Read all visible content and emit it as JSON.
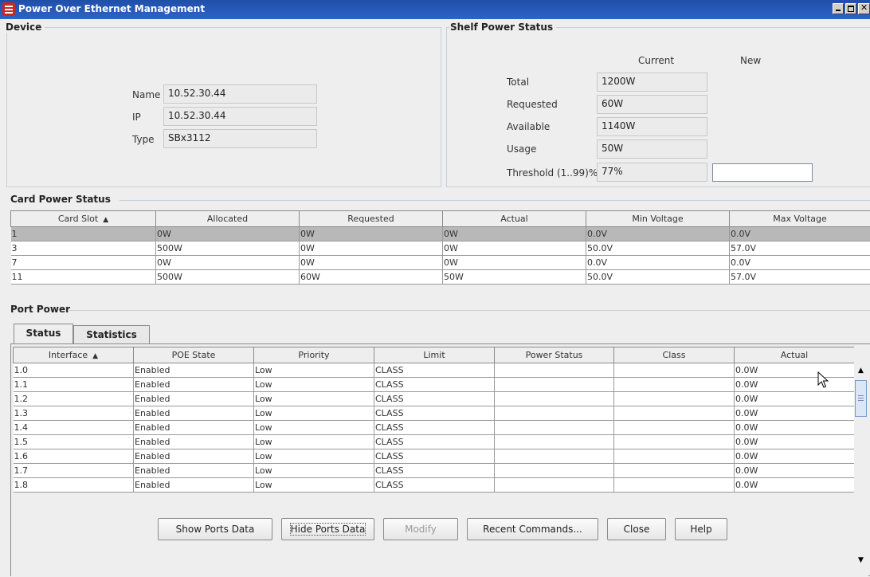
{
  "window": {
    "title": "Power Over Ethernet Management"
  },
  "device": {
    "heading": "Device",
    "name_label": "Name",
    "name_value": "10.52.30.44",
    "ip_label": "IP",
    "ip_value": "10.52.30.44",
    "type_label": "Type",
    "type_value": "SBx3112"
  },
  "shelf": {
    "heading": "Shelf Power Status",
    "current_header": "Current",
    "new_header": "New",
    "rows": [
      {
        "label": "Total",
        "value": "1200W"
      },
      {
        "label": "Requested",
        "value": "60W"
      },
      {
        "label": "Available",
        "value": "1140W"
      },
      {
        "label": "Usage",
        "value": "50W"
      },
      {
        "label": "Threshold (1..99)%",
        "value": "77%"
      }
    ],
    "threshold_new": ""
  },
  "card": {
    "heading": "Card Power Status",
    "sort_icon": "up-triangle-icon",
    "columns": [
      "Card Slot",
      "Allocated",
      "Requested",
      "Actual",
      "Min Voltage",
      "Max Voltage"
    ],
    "rows": [
      [
        "1",
        "0W",
        "0W",
        "0W",
        "0.0V",
        "0.0V"
      ],
      [
        "3",
        "500W",
        "0W",
        "0W",
        "50.0V",
        "57.0V"
      ],
      [
        "7",
        "0W",
        "0W",
        "0W",
        "0.0V",
        "0.0V"
      ],
      [
        "11",
        "500W",
        "60W",
        "50W",
        "50.0V",
        "57.0V"
      ]
    ]
  },
  "port": {
    "heading": "Port Power",
    "tabs": [
      "Status",
      "Statistics"
    ],
    "columns": [
      "Interface",
      "POE State",
      "Priority",
      "Limit",
      "Power Status",
      "Class",
      "Actual"
    ],
    "rows": [
      [
        "1.0",
        "Enabled",
        "Low",
        "CLASS",
        "",
        "",
        "0.0W"
      ],
      [
        "1.1",
        "Enabled",
        "Low",
        "CLASS",
        "",
        "",
        "0.0W"
      ],
      [
        "1.2",
        "Enabled",
        "Low",
        "CLASS",
        "",
        "",
        "0.0W"
      ],
      [
        "1.3",
        "Enabled",
        "Low",
        "CLASS",
        "",
        "",
        "0.0W"
      ],
      [
        "1.4",
        "Enabled",
        "Low",
        "CLASS",
        "",
        "",
        "0.0W"
      ],
      [
        "1.5",
        "Enabled",
        "Low",
        "CLASS",
        "",
        "",
        "0.0W"
      ],
      [
        "1.6",
        "Enabled",
        "Low",
        "CLASS",
        "",
        "",
        "0.0W"
      ],
      [
        "1.7",
        "Enabled",
        "Low",
        "CLASS",
        "",
        "",
        "0.0W"
      ],
      [
        "1.8",
        "Enabled",
        "Low",
        "CLASS",
        "",
        "",
        "0.0W"
      ]
    ]
  },
  "buttons": {
    "show_ports": "Show Ports Data",
    "hide_ports": "Hide Ports Data",
    "modify": "Modify",
    "recent": "Recent Commands...",
    "close": "Close",
    "help": "Help"
  }
}
